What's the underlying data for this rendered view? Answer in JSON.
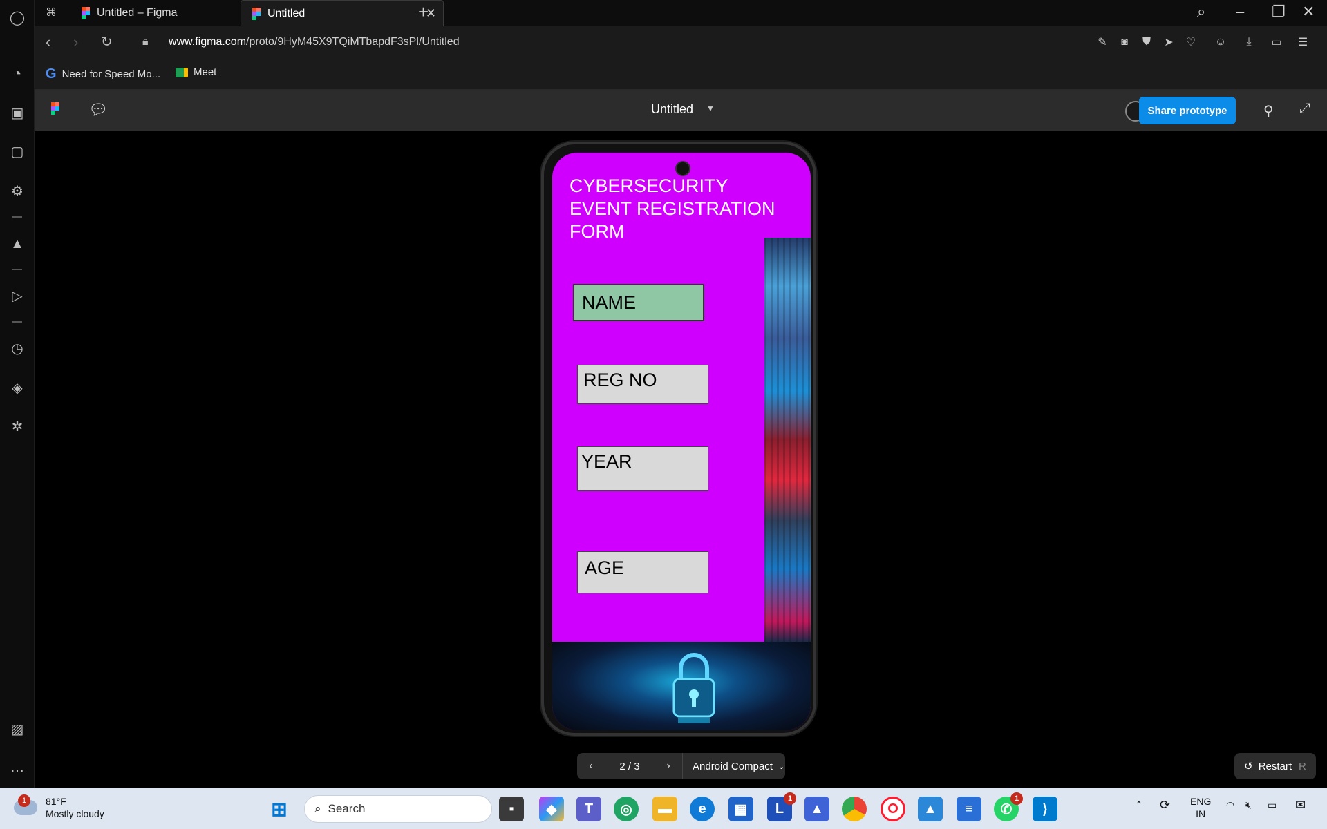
{
  "browser": {
    "tabs": [
      {
        "label": "Untitled – Figma"
      },
      {
        "label": "Untitled"
      }
    ],
    "url_domain": "www.figma.com",
    "url_path": "/proto/9HyM45X9TQiMTbapdF3sPl/Untitled",
    "bookmarks": [
      {
        "label": "Need for Speed Mo..."
      },
      {
        "label": "Meet"
      }
    ]
  },
  "figma": {
    "file_title": "Untitled",
    "share_label": "Share prototype",
    "accent": "#0c8ce9"
  },
  "prototype": {
    "form_title": "CYBERSECURITY EVENT REGISTRATION FORM",
    "fields": {
      "name": "NAME",
      "reg_no": "REG NO",
      "year": "YEAR",
      "age": "AGE"
    },
    "background_color": "#d000ff",
    "name_field_color": "#8fc7a4",
    "page_indicator": "2 / 3",
    "device": "Android Compact",
    "restart_label": "Restart",
    "restart_key": "R"
  },
  "taskbar": {
    "weather_badge": "1",
    "temperature": "81°F",
    "condition": "Mostly cloudy",
    "search_placeholder": "Search",
    "apps": [
      {
        "name": "start-icon"
      },
      {
        "name": "file-explorer-icon"
      },
      {
        "name": "copilot-icon"
      },
      {
        "name": "teams-icon"
      },
      {
        "name": "edge-icon"
      },
      {
        "name": "store-icon"
      },
      {
        "name": "chrome-icon"
      },
      {
        "name": "opera-icon"
      },
      {
        "name": "vscode-icon"
      }
    ],
    "app_badge_l": "1",
    "app_badge_whatsapp": "1",
    "lang_top": "ENG",
    "lang_bottom": "IN"
  }
}
